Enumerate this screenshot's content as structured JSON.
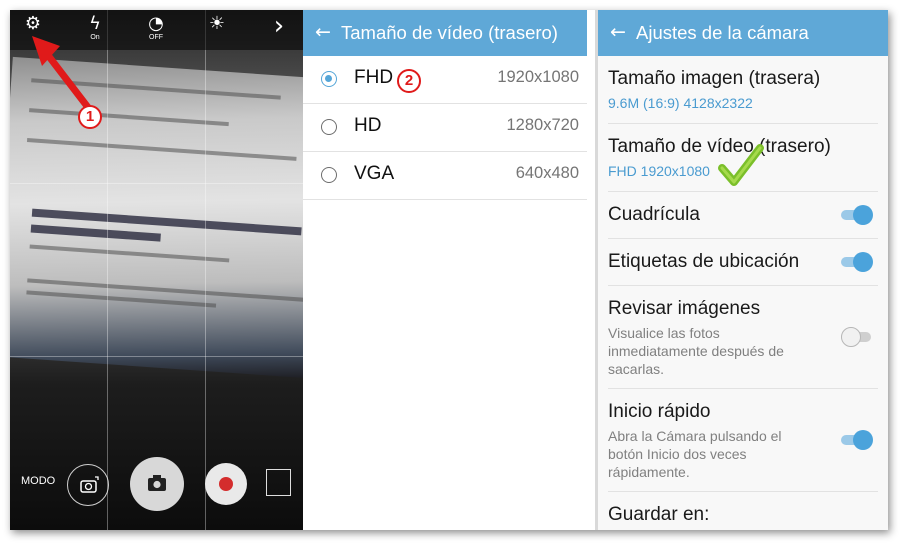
{
  "camera": {
    "top_icons": [
      {
        "name": "settings-gear-icon",
        "glyph": "⚙",
        "sub": ""
      },
      {
        "name": "flash-icon",
        "glyph": "ϟ",
        "sub": "On"
      },
      {
        "name": "timer-icon",
        "glyph": "◔",
        "sub": "OFF"
      },
      {
        "name": "hdr-brightness-icon",
        "glyph": "☀",
        "sub": ""
      },
      {
        "name": "more-chevron-icon",
        "glyph": "›",
        "sub": ""
      }
    ],
    "mode_label": "MODO",
    "annotation_1": "1"
  },
  "video_size": {
    "back_icon": "←",
    "title": "Tamaño de vídeo (trasero)",
    "annotation_2": "2",
    "options": [
      {
        "label": "FHD",
        "resolution": "1920x1080",
        "selected": true
      },
      {
        "label": "HD",
        "resolution": "1280x720",
        "selected": false
      },
      {
        "label": "VGA",
        "resolution": "640x480",
        "selected": false
      }
    ]
  },
  "settings": {
    "back_icon": "←",
    "title": "Ajustes de la cámara",
    "items": [
      {
        "title": "Tamaño imagen (trasera)",
        "value": "9.6M (16:9) 4128x2322"
      },
      {
        "title": "Tamaño de vídeo (trasero)",
        "value": "FHD 1920x1080"
      },
      {
        "title": "Cuadrícula",
        "toggle": true
      },
      {
        "title": "Etiquetas de ubicación",
        "toggle": true
      },
      {
        "title": "Revisar imágenes",
        "desc": "Visualice las fotos inmediatamente después de sacarlas.",
        "toggle": false
      },
      {
        "title": "Inicio rápido",
        "desc": "Abra la Cámara pulsando el botón Inicio dos veces rápidamente.",
        "toggle": true
      },
      {
        "title": "Guardar en:"
      }
    ]
  },
  "colors": {
    "appbar": "#5fa8d7",
    "accent": "#4ba3db",
    "annotation_red": "#e01a1a",
    "checkmark_green": "#7bbf2a"
  }
}
